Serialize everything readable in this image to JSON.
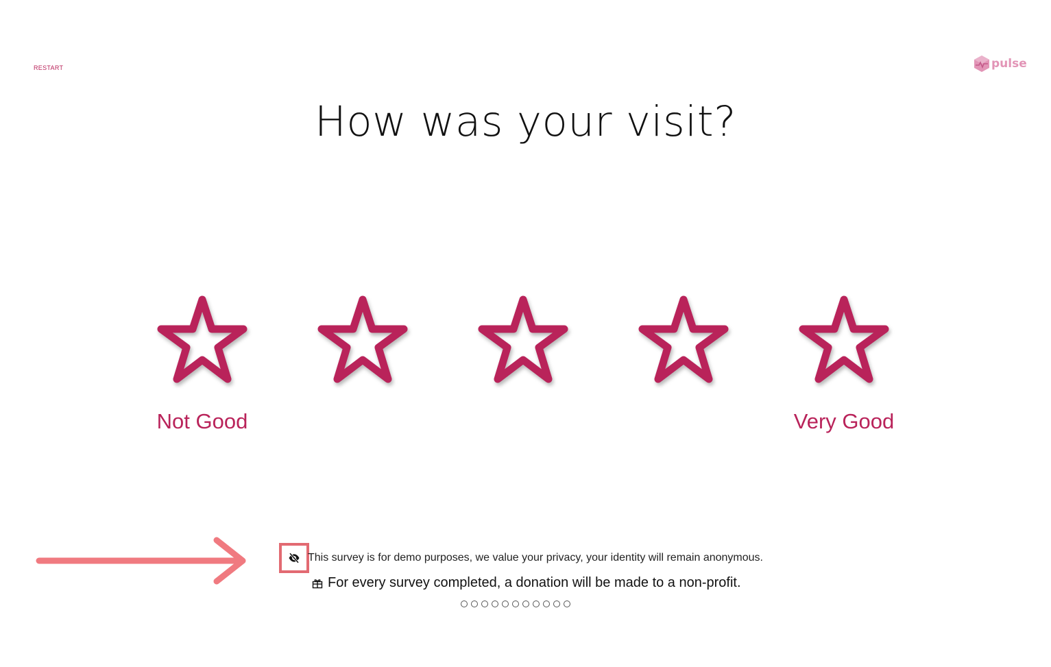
{
  "header": {
    "restart_label": "RESTART",
    "brand_name": "pulse"
  },
  "question": {
    "title": "How was your visit?"
  },
  "rating": {
    "max_stars": 5,
    "selected": 0,
    "min_label": "Not Good",
    "max_label": "Very Good"
  },
  "footer": {
    "privacy_text": "This survey is for demo purposes, we value your privacy, your identity will remain anonymous.",
    "donation_text": "For every survey completed, a donation will be made to a non-profit.",
    "privacy_icon": "eye-slash-icon",
    "donation_icon": "gift-icon"
  },
  "progress": {
    "total_pages": 11,
    "current_page": 0
  },
  "colors": {
    "accent": "#b9235a",
    "brand": "#e294b6",
    "annotation": "#e26a72"
  }
}
